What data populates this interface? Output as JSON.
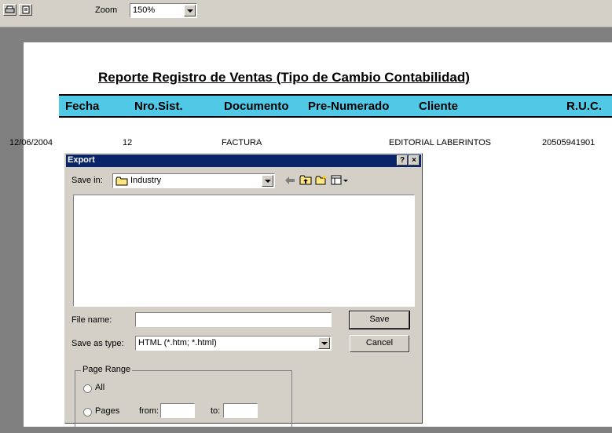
{
  "toolbar": {
    "print_icon": "print-icon",
    "export_icon": "export-icon",
    "zoom_label": "Zoom",
    "zoom_value": "150%"
  },
  "report": {
    "title": "Reporte Registro de Ventas (Tipo de Cambio Contabilidad)",
    "header_color": "#4fc9e6",
    "columns": [
      "Fecha",
      "Nro.Sist.",
      "Documento",
      "Pre-Numerado",
      "Cliente",
      "R.U.C."
    ],
    "rows": [
      [
        "12/06/2004",
        "12",
        "FACTURA",
        "",
        "EDITORIAL LABERINTOS",
        "20505941901"
      ]
    ]
  },
  "dialog": {
    "title": "Export",
    "help_label": "?",
    "close_label": "×",
    "save_in_label": "Save in:",
    "save_in_value": "Industry",
    "file_name_label": "File name:",
    "file_name_value": "",
    "save_as_type_label": "Save as type:",
    "save_as_type_value": "HTML (*.htm; *.html)",
    "save_button": "Save",
    "cancel_button": "Cancel",
    "page_range": {
      "legend": "Page Range",
      "all_label": "All",
      "pages_label": "Pages",
      "from_label": "from:",
      "to_label": "to:",
      "from_value": "",
      "to_value": ""
    },
    "titlebar_color": "#0a246a"
  }
}
